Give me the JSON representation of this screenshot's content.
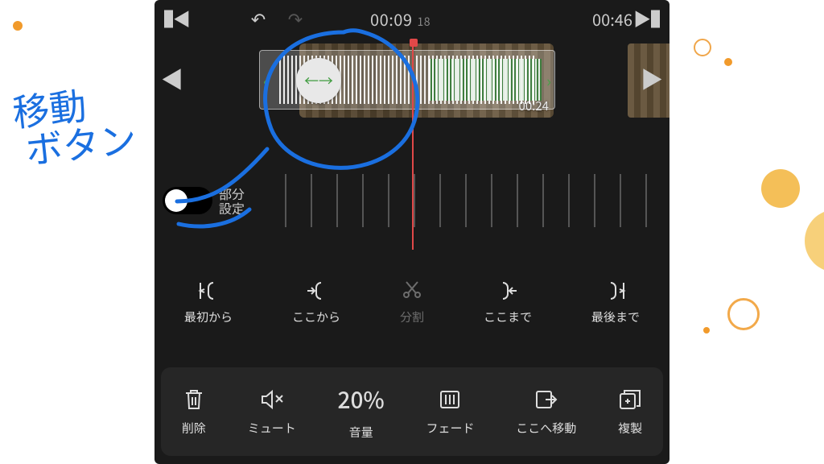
{
  "time": {
    "current": "00:09",
    "frame": "18",
    "duration": "00:46"
  },
  "clip": {
    "duration_label": "00:24"
  },
  "toggle": {
    "line1": "部分",
    "line2": "設定"
  },
  "trim": {
    "from_start": "最初から",
    "from_here": "ここから",
    "split": "分割",
    "to_here": "ここまで",
    "to_end": "最後まで"
  },
  "bottom": {
    "delete": "削除",
    "mute": "ミュート",
    "volume_value": "20%",
    "volume_label": "音量",
    "fade": "フェード",
    "move_here": "ここへ移動",
    "duplicate": "複製"
  },
  "annotation": {
    "line1": "移動",
    "line2": "ボタン"
  }
}
